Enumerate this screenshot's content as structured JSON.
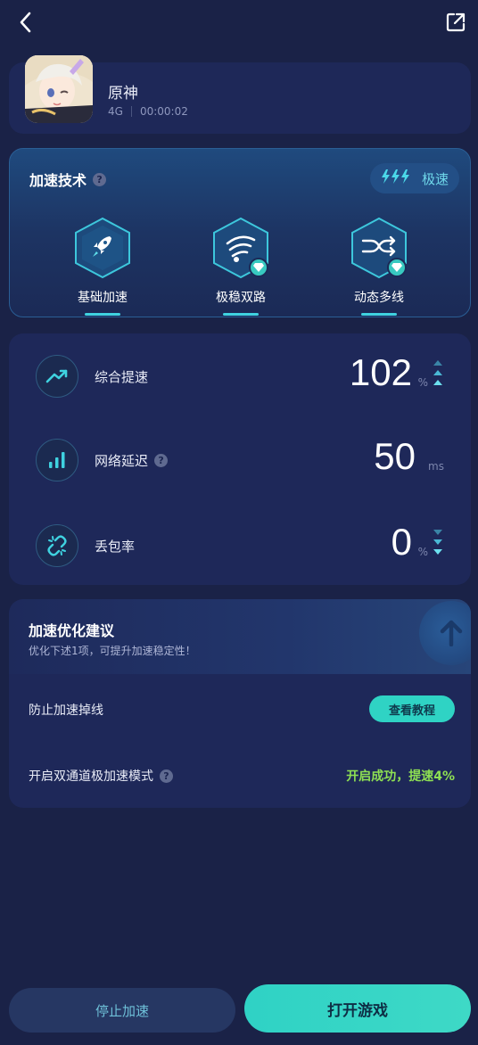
{
  "header": {
    "back_icon": "chevron-left-icon",
    "share_icon": "external-link-icon"
  },
  "game": {
    "title": "原神",
    "network": "4G",
    "elapsed": "00:00:02",
    "icon": "genshin-app-icon"
  },
  "tech": {
    "title": "加速技术",
    "help_icon": "question-circle-icon",
    "speed_badge_label": "极速",
    "speed_badge_icon": "triple-bolt-icon",
    "items": [
      {
        "label": "基础加速",
        "icon": "rocket-icon",
        "premium": false
      },
      {
        "label": "极稳双路",
        "icon": "wifi-signal-icon",
        "premium": true
      },
      {
        "label": "动态多线",
        "icon": "multi-route-icon",
        "premium": true
      }
    ]
  },
  "stats": {
    "rows": [
      {
        "label": "综合提速",
        "value": "102",
        "unit": "%",
        "icon": "trend-up-icon",
        "has_help": false
      },
      {
        "label": "网络延迟",
        "value": "50",
        "unit": "ms",
        "icon": "signal-bars-icon",
        "has_help": true
      },
      {
        "label": "丢包率",
        "value": "0",
        "unit": "%",
        "icon": "broken-link-icon",
        "has_help": false
      }
    ]
  },
  "advice": {
    "title": "加速优化建议",
    "subtitle": "优化下述1项，可提升加速稳定性！",
    "row1_label": "防止加速掉线",
    "row1_button": "查看教程",
    "row2_label": "开启双通道极加速模式",
    "row2_status": "开启成功，提速4%"
  },
  "footer": {
    "stop_label": "停止加速",
    "open_label": "打开游戏"
  },
  "colors": {
    "background": "#1a2247",
    "accent": "#2fd3c4",
    "success": "#8ee053"
  }
}
